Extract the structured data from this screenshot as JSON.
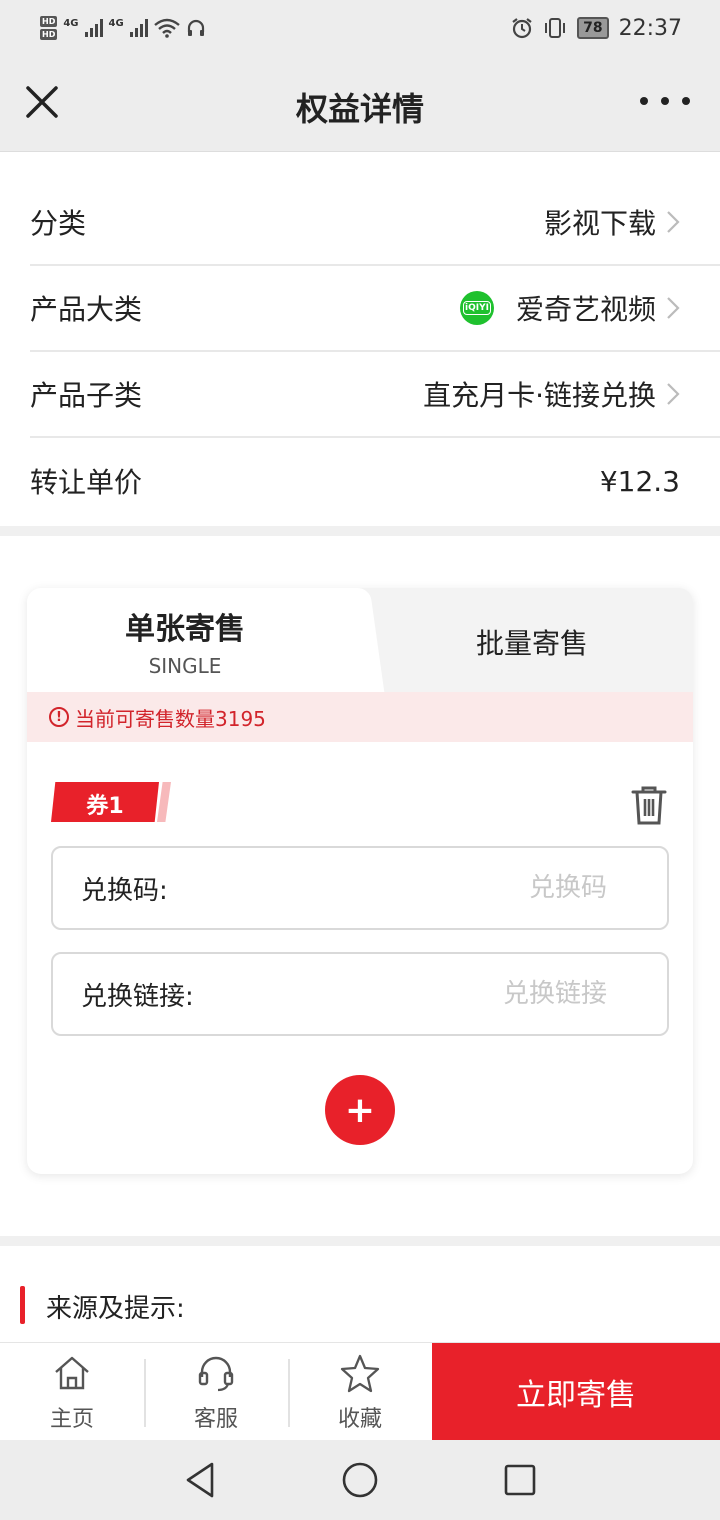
{
  "status_bar": {
    "hd1": "HD",
    "hd2": "HD",
    "net1": "4G",
    "net2": "4G",
    "battery": "78",
    "time": "22:37"
  },
  "header": {
    "title": "权益详情"
  },
  "info": {
    "rows": [
      {
        "label": "分类",
        "value": "影视下载"
      },
      {
        "label": "产品大类",
        "value": "爱奇艺视频"
      },
      {
        "label": "产品子类",
        "value": "直充月卡·链接兑换"
      },
      {
        "label": "转让单价",
        "value": "¥12.3"
      }
    ],
    "iqiyi_logo_text": "iQIYI"
  },
  "tabs": {
    "single_title": "单张寄售",
    "single_sub": "SINGLE",
    "batch_title": "批量寄售"
  },
  "notice": {
    "text": "当前可寄售数量3195"
  },
  "coupon": {
    "tag": "券1",
    "code_label": "兑换码:",
    "code_placeholder": "兑换码",
    "link_label": "兑换链接:",
    "link_placeholder": "兑换链接",
    "add_symbol": "+"
  },
  "source": {
    "title": "来源及提示:"
  },
  "bottom_bar": {
    "home": "主页",
    "service": "客服",
    "favorite": "收藏",
    "sell": "立即寄售"
  },
  "colors": {
    "accent": "#e8212a",
    "notice_bg": "#fbe9e9",
    "iqiyi_green": "#1fc12e"
  },
  "icons": [
    "close-icon",
    "more-icon",
    "chevron-right-icon",
    "alert-icon",
    "trash-icon",
    "plus-icon",
    "home-icon",
    "headset-icon",
    "star-icon",
    "back-icon",
    "home-circle-icon",
    "recents-icon"
  ]
}
